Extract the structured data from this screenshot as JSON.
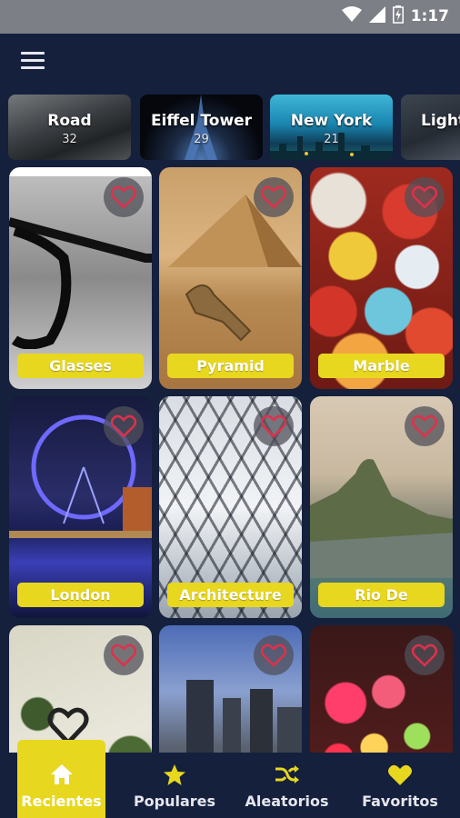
{
  "status_bar": {
    "time": "1:17",
    "icons": [
      "wifi-icon",
      "signal-icon",
      "battery-icon"
    ]
  },
  "app_bar": {
    "menu_icon": "hamburger-menu-icon"
  },
  "categories": [
    {
      "name": "Road",
      "count": "32"
    },
    {
      "name": "Eiffel Tower",
      "count": "29"
    },
    {
      "name": "New York",
      "count": "21"
    },
    {
      "name": "Light",
      "count": ""
    }
  ],
  "wallpapers": [
    {
      "title": "Glasses",
      "favorite_icon": "heart-outline-icon"
    },
    {
      "title": "Pyramid",
      "favorite_icon": "heart-outline-icon"
    },
    {
      "title": "Marble",
      "favorite_icon": "heart-outline-icon"
    },
    {
      "title": "London",
      "favorite_icon": "heart-outline-icon"
    },
    {
      "title": "Architecture",
      "favorite_icon": "heart-outline-icon"
    },
    {
      "title": "Rio De",
      "favorite_icon": "heart-outline-icon"
    },
    {
      "title": "",
      "favorite_icon": "heart-outline-icon"
    },
    {
      "title": "",
      "favorite_icon": "heart-outline-icon"
    },
    {
      "title": "",
      "favorite_icon": "heart-outline-icon"
    }
  ],
  "bottom_nav": [
    {
      "label": "Recientes",
      "icon": "home-icon",
      "active": true
    },
    {
      "label": "Populares",
      "icon": "star-icon",
      "active": false
    },
    {
      "label": "Aleatorios",
      "icon": "shuffle-icon",
      "active": false
    },
    {
      "label": "Favoritos",
      "icon": "heart-icon",
      "active": false
    }
  ],
  "colors": {
    "background": "#15203d",
    "accent": "#e8d71f",
    "status_bar": "#7c7f86",
    "heart": "#e0304a",
    "nav_icon": "#e8d71f"
  }
}
